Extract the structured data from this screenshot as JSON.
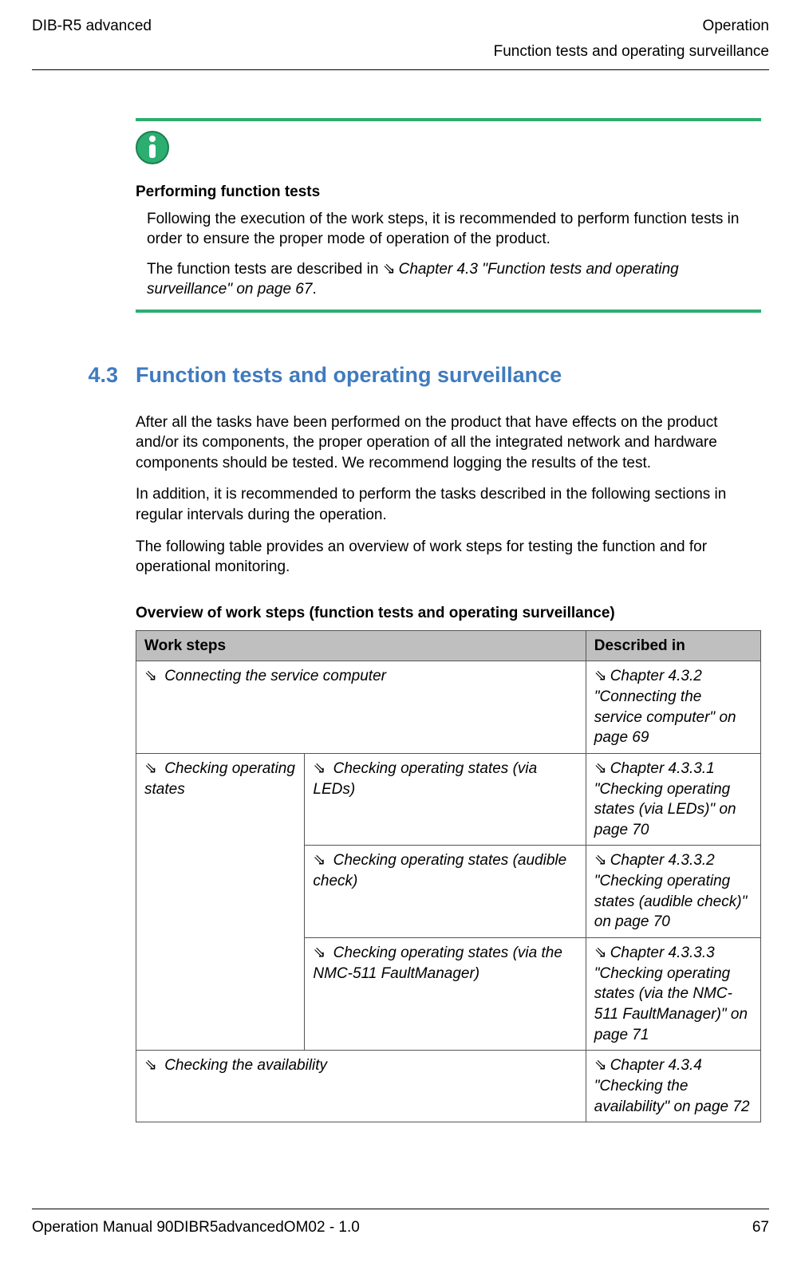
{
  "header": {
    "left": "DIB-R5 advanced",
    "right": "Operation",
    "sub": "Function tests and operating surveillance"
  },
  "info": {
    "title": "Performing function tests",
    "p1": "Following the execution of the work steps, it is recommended to perform function tests in order to ensure the proper mode of operation of the product.",
    "p2_prefix": "The function tests are described in ",
    "p2_ref": "Chapter 4.3 \"Function tests and operating surveillance\" on page 67",
    "p2_suffix": "."
  },
  "section": {
    "number": "4.3",
    "title": "Function tests and operating surveillance"
  },
  "body": {
    "p1": "After all the tasks have been performed on the product that have effects on the product and/or its components, the proper operation of all the integrated network and hardware components should be tested. We recommend logging the results of the test.",
    "p2": "In addition, it is recommended to perform the tasks described in the following sections in regular intervals during the operation.",
    "p3": "The following table provides an overview of work steps for testing the function and for operational monitoring."
  },
  "table": {
    "title": "Overview of work steps (function tests and operating surveillance)",
    "head_ws": "Work steps",
    "head_desc": "Described in",
    "r1_ws": "Connecting the service computer",
    "r1_desc": "Chapter 4.3.2 \"Connecting the service computer\" on page 69",
    "r2_ws": "Checking operating states",
    "r2a_sub": "Checking operating states (via LEDs)",
    "r2a_desc": "Chapter 4.3.3.1 \"Checking operating states (via LEDs)\" on page 70",
    "r2b_sub": "Checking operating states (audible check)",
    "r2b_desc": "Chapter 4.3.3.2 \"Checking operating states (audible check)\" on page 70",
    "r2c_sub": "Checking operating states (via the NMC-511 FaultManager)",
    "r2c_desc": "Chapter 4.3.3.3 \"Checking operating states (via the NMC-511 FaultManager)\" on page 71",
    "r3_ws": "Checking the availability",
    "r3_desc": "Chapter 4.3.4 \"Checking the availability\" on page 72"
  },
  "footer": {
    "left": "Operation Manual 90DIBR5advancedOM02 - 1.0",
    "right": "67"
  },
  "icons": {
    "arrow": "⇘"
  }
}
